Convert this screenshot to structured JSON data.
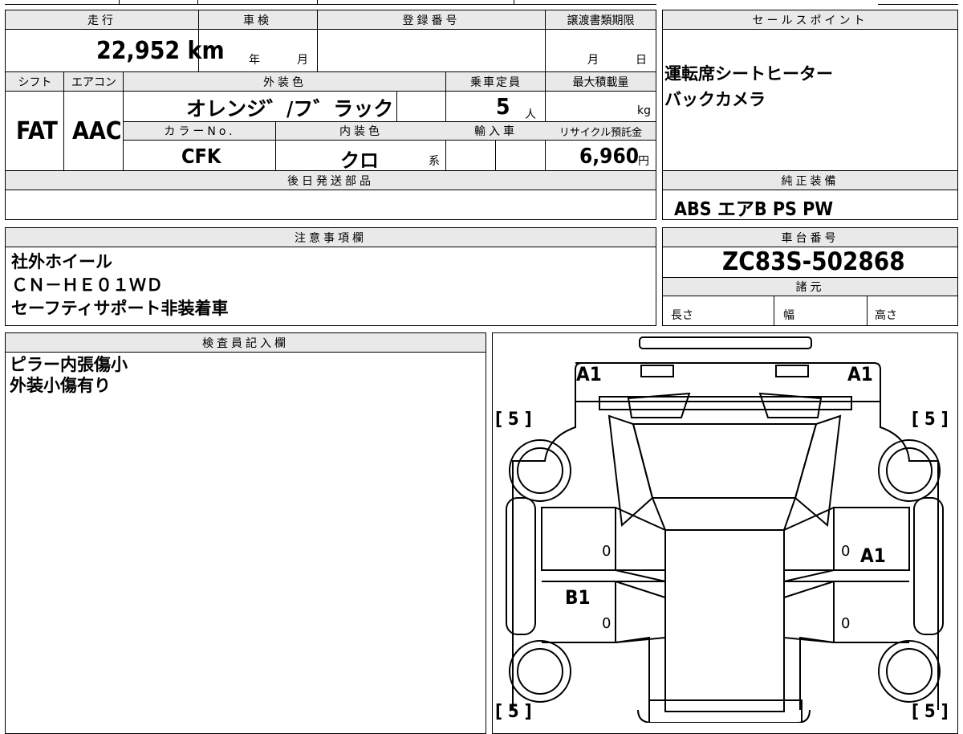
{
  "header": {
    "mileage_label": "走行",
    "inspection_label": "車検",
    "registration_label": "登録番号",
    "transfer_deadline_label": "譲渡書類期限",
    "sales_points_label": "セールスポイント"
  },
  "values": {
    "mileage": "22,952 km",
    "inspection_year_unit": "年",
    "inspection_month_unit": "月",
    "transfer_month_unit": "月",
    "transfer_day_unit": "日"
  },
  "row2": {
    "shift_label": "シフト",
    "aircon_label": "エアコン",
    "exterior_color_label": "外装色",
    "capacity_label": "乗車定員",
    "max_load_label": "最大積載量",
    "shift": "FAT",
    "aircon": "AAC",
    "exterior_color": "オレンジ゛/フ゛ラック",
    "capacity": "5",
    "capacity_unit": "人",
    "max_load_unit": "kg",
    "color_no_label": "カラーNo.",
    "interior_color_label": "内装色",
    "import_label": "輸入車",
    "recycle_label": "リサイクル預託金",
    "color_no": "CFK",
    "interior_color": "クロ",
    "interior_suffix": "系",
    "recycle_fee": "6,960",
    "recycle_unit": "円"
  },
  "later_parts_label": "後日発送部品",
  "sales_points": [
    "運転席シートヒーター",
    "バックカメラ"
  ],
  "genuine_equipment_label": "純正装備",
  "genuine_equipment": "ABS エアB PS PW",
  "notes_label": "注意事項欄",
  "notes": [
    "社外ホイール",
    "ＣＮ－ＨＥ０１ＷＤ",
    "セーフティサポート非装着車"
  ],
  "chassis_label": "車台番号",
  "chassis_number": "ZC83S-502868",
  "specs_label": "諸元",
  "specs": {
    "length": "長さ",
    "width": "幅",
    "height": "高さ"
  },
  "inspector_label": "検査員記入欄",
  "inspector_notes": [
    "ピラー内張傷小",
    "外装小傷有り"
  ],
  "diagram": {
    "tl": "A1",
    "tr": "A1",
    "right_door": "A1",
    "left_door": "B1",
    "tire_fl": "[ 5 ]",
    "tire_fr": "[ 5 ]",
    "tire_rl": "[ 5 ]",
    "tire_rr": "[ 5 ]",
    "zero": "0"
  }
}
